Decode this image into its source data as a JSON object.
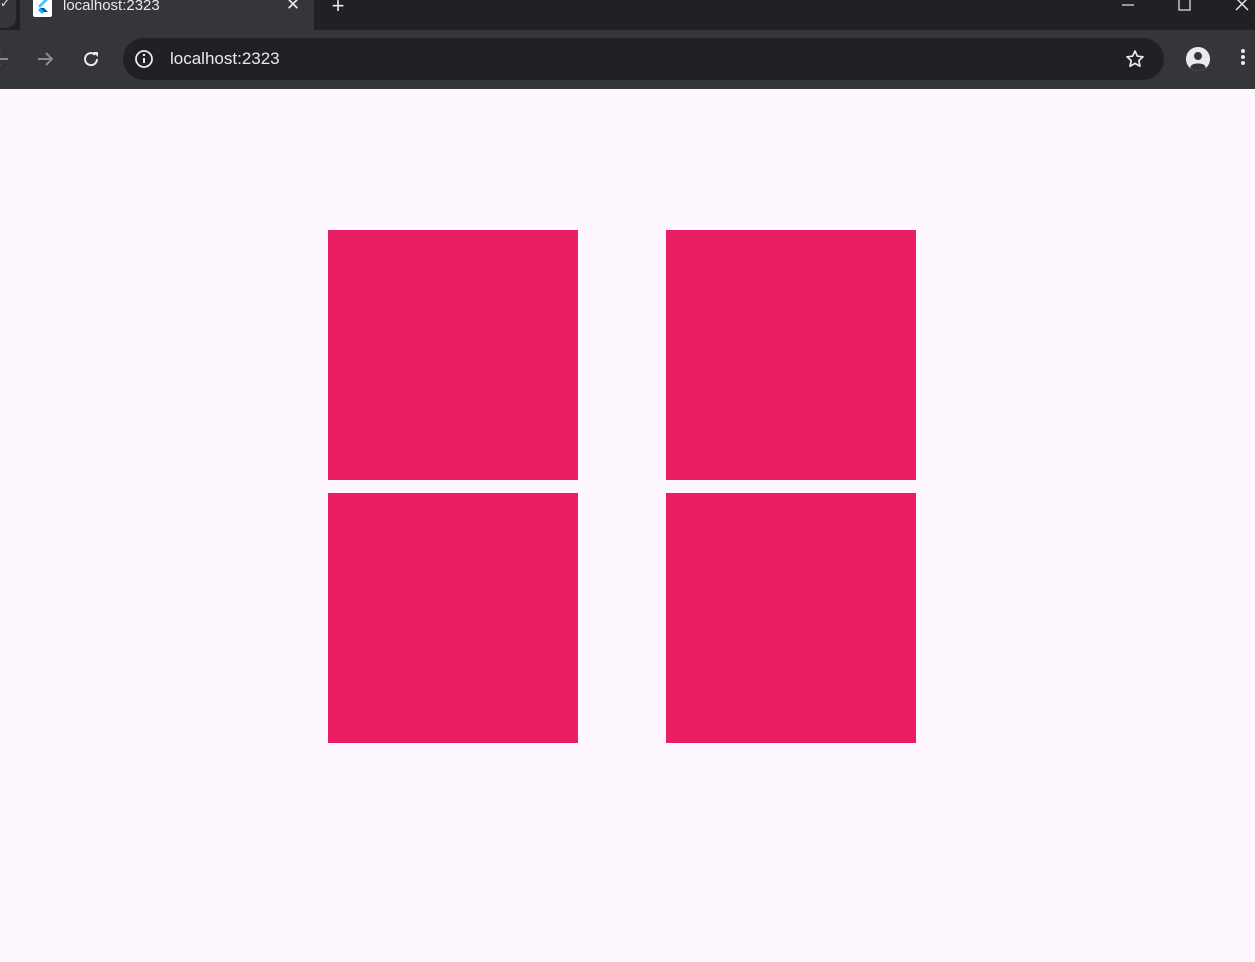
{
  "browser": {
    "tab": {
      "title": "localhost:2323",
      "favicon": "flutter-logo-icon"
    },
    "omnibox": {
      "url": "localhost:2323"
    },
    "icons": {
      "back": "arrow-back-icon",
      "forward": "arrow-forward-icon",
      "reload": "reload-icon",
      "site_info": "info-icon",
      "bookmark": "star-icon",
      "profile": "profile-icon",
      "menu": "more-vert-icon",
      "new_tab": "plus-icon",
      "close_tab": "close-icon"
    },
    "colors": {
      "tabstrip": "#202124",
      "toolbar": "#35363a",
      "omnibox": "#202124",
      "text": "#e8eaed"
    }
  },
  "page": {
    "background": "#fef7ff",
    "tile_color": "#e91e63",
    "tiles": [
      {
        "id": "tile-1"
      },
      {
        "id": "tile-2"
      },
      {
        "id": "tile-3"
      },
      {
        "id": "tile-4"
      }
    ]
  }
}
